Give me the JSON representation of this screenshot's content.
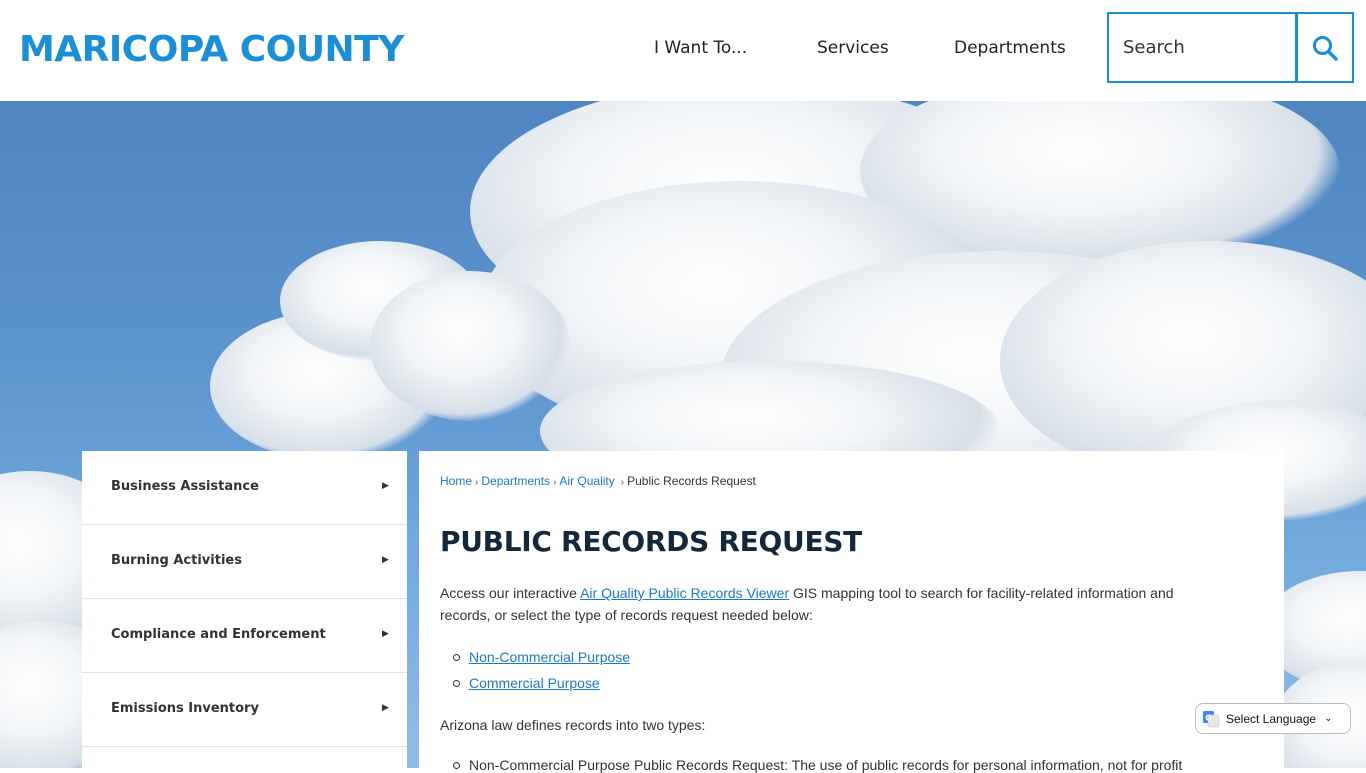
{
  "header": {
    "logo_text": "MARICOPA COUNTY",
    "nav": [
      "I Want To...",
      "Services",
      "Departments"
    ],
    "search_placeholder": "Search"
  },
  "sidebar": {
    "items": [
      {
        "label": "Business Assistance"
      },
      {
        "label": "Burning Activities"
      },
      {
        "label": "Compliance and Enforcement"
      },
      {
        "label": "Emissions Inventory"
      }
    ]
  },
  "breadcrumb": {
    "home": "Home",
    "departments": "Departments",
    "air_quality": "Air Quality",
    "current": "Public Records Request"
  },
  "main": {
    "title": "PUBLIC RECORDS REQUEST",
    "intro_before": "Access our interactive ",
    "intro_link": "Air Quality Public Records Viewer",
    "intro_after": " GIS mapping tool to search for facility-related information and records, or select the type of records request needed below:",
    "links": [
      "Non-Commercial Purpose",
      "Commercial Purpose"
    ],
    "law_text": "Arizona law defines records into two types:",
    "partial_bullet": "Non-Commercial Purpose Public Records Request: The use of public records for personal information, not for profit"
  },
  "translate": {
    "label": "Select Language"
  },
  "colors": {
    "brand_blue": "#1a8fd6",
    "link_blue": "#1a7ac9",
    "title_navy": "#14283c"
  }
}
